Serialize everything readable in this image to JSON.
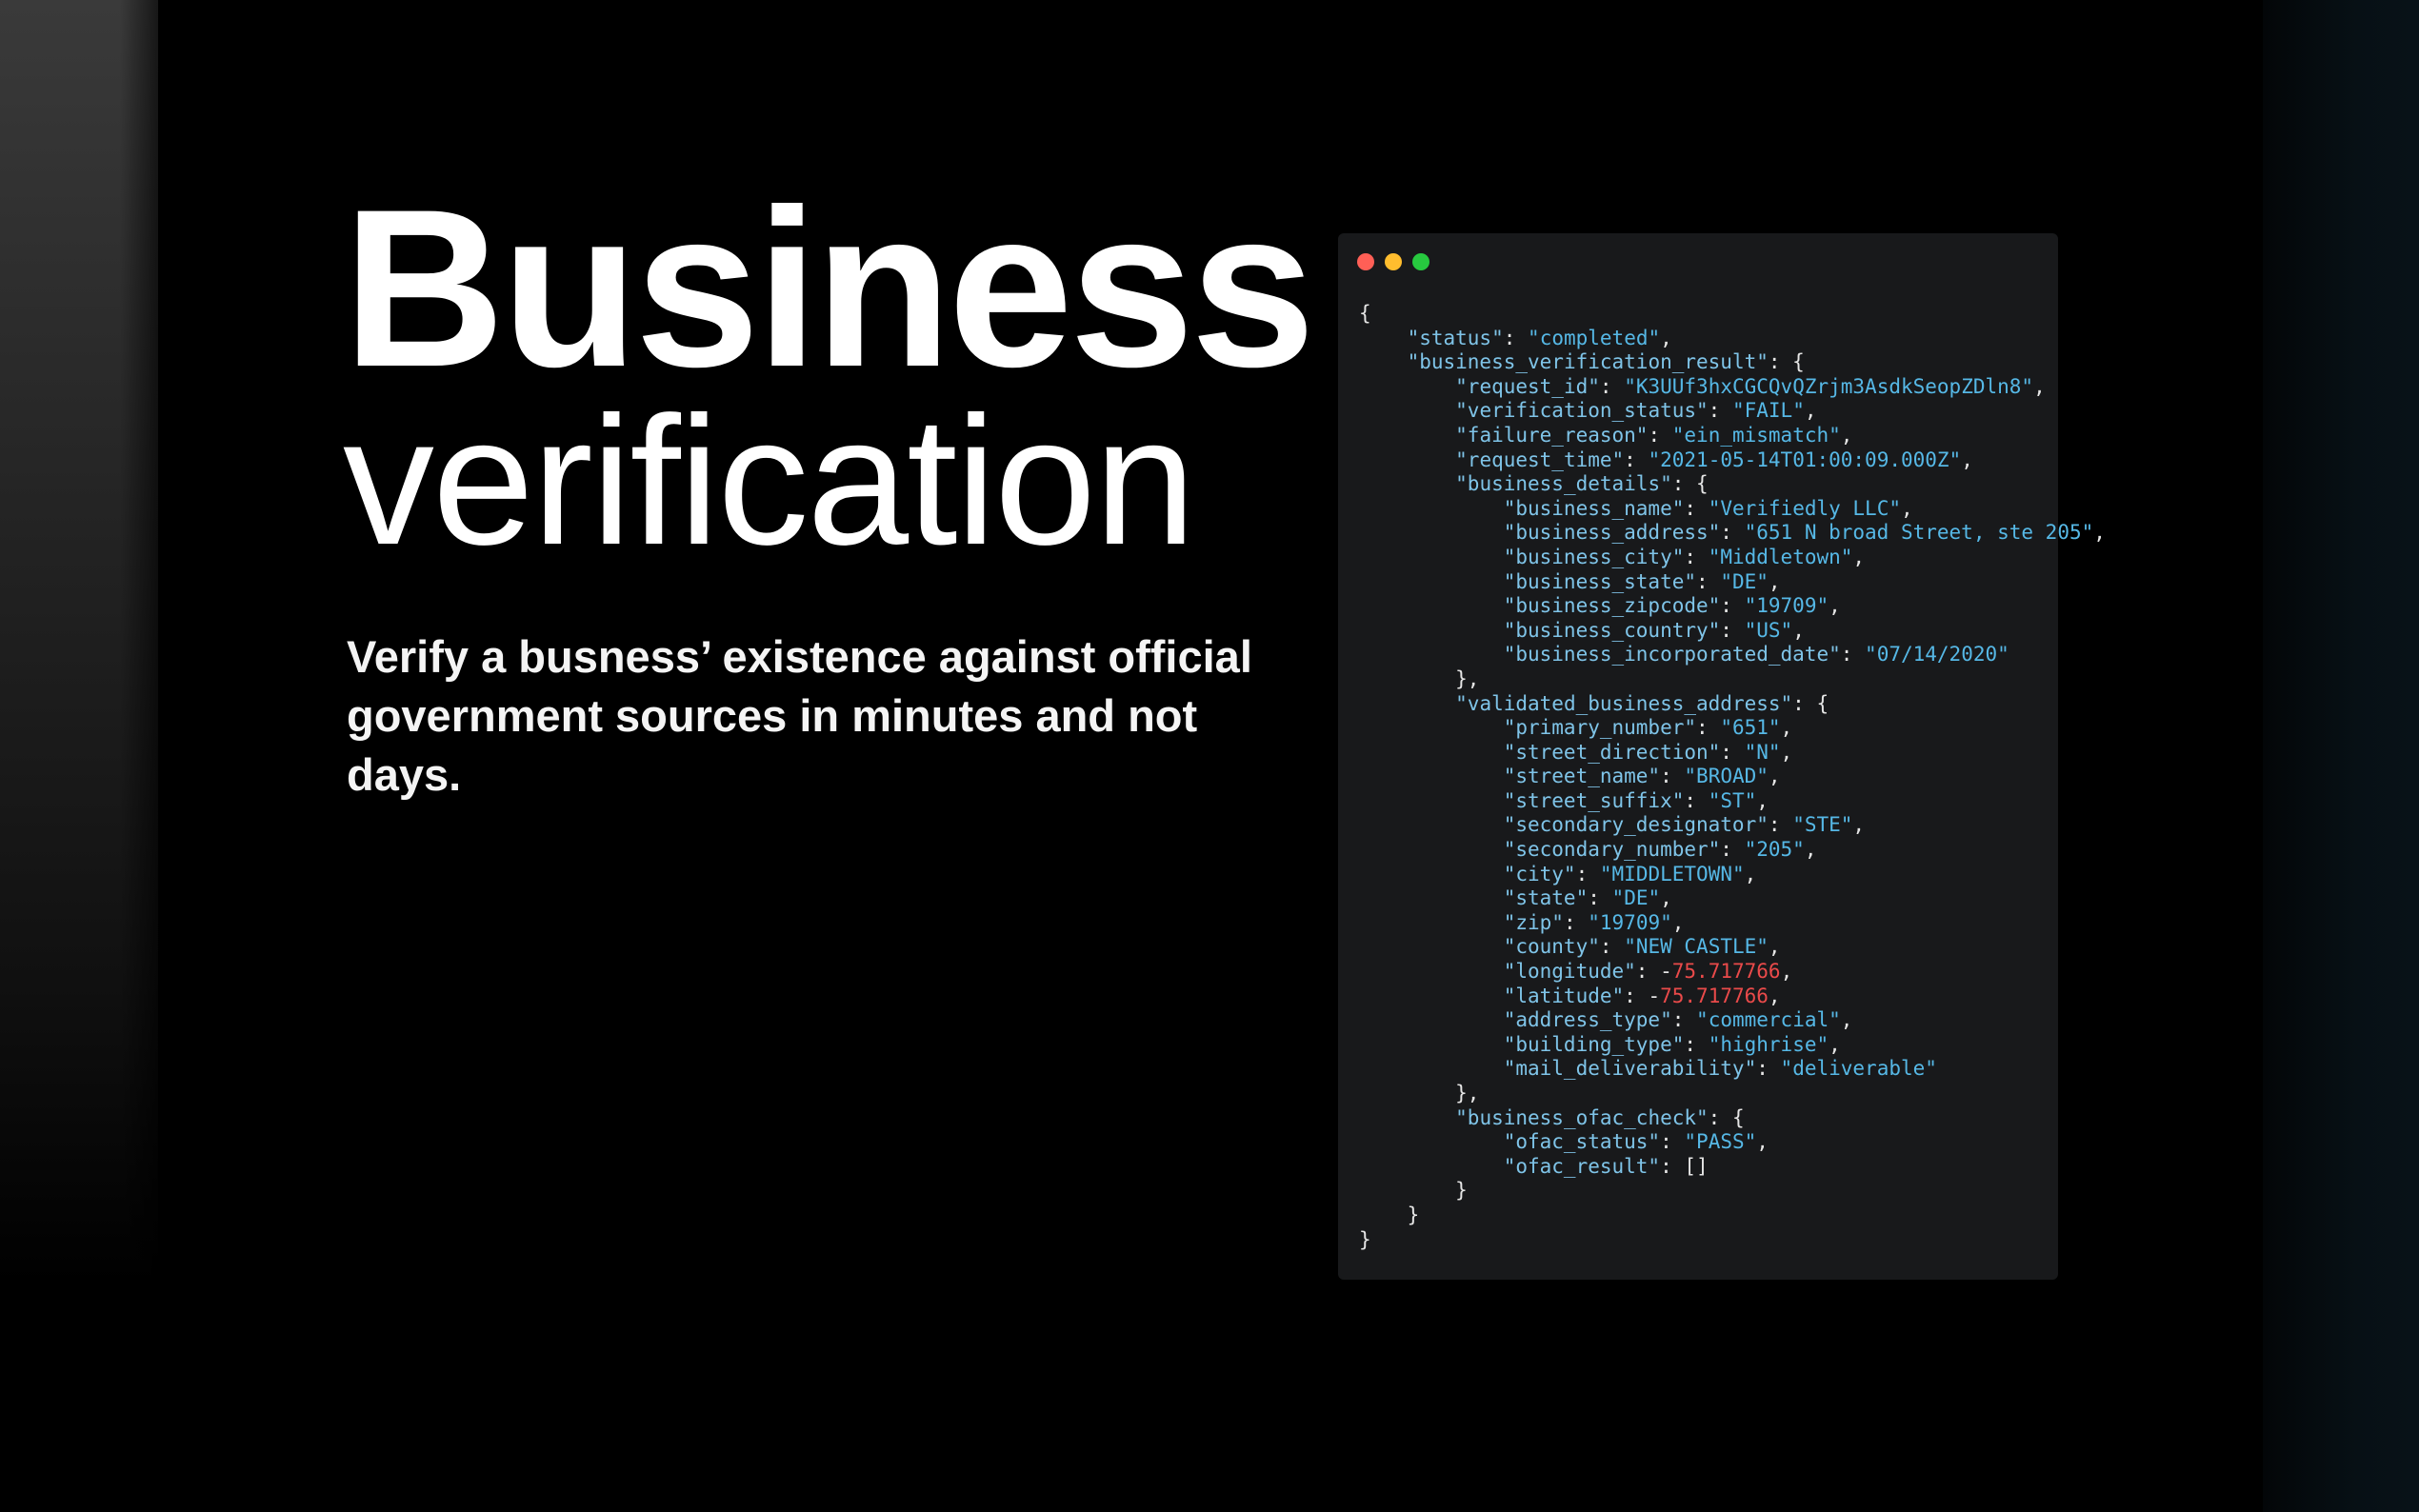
{
  "hero": {
    "title_line1": "Business",
    "title_line2": "verification",
    "description": "Verify a busness’ existence against official government sources in minutes and not days."
  },
  "code_window": {
    "traffic_lights": [
      {
        "name": "close",
        "color": "#ff5f56"
      },
      {
        "name": "minimize",
        "color": "#ffbd2e"
      },
      {
        "name": "maximize",
        "color": "#27c93f"
      }
    ],
    "lines": [
      {
        "indent": 0,
        "text": "{"
      },
      {
        "indent": 1,
        "key": "status",
        "value": "completed",
        "type": "string",
        "suffix": ","
      },
      {
        "indent": 1,
        "key": "business_verification_result",
        "suffix": " {"
      },
      {
        "indent": 2,
        "key": "request_id",
        "value": "K3UUf3hxCGCQvQZrjm3AsdkSeopZDln8",
        "type": "string",
        "suffix": ","
      },
      {
        "indent": 2,
        "key": "verification_status",
        "value": "FAIL",
        "type": "string",
        "suffix": ","
      },
      {
        "indent": 2,
        "key": "failure_reason",
        "value": "ein_mismatch",
        "type": "string",
        "suffix": ","
      },
      {
        "indent": 2,
        "key": "request_time",
        "value": "2021-05-14T01:00:09.000Z",
        "type": "string",
        "suffix": ","
      },
      {
        "indent": 2,
        "key": "business_details",
        "suffix": " {"
      },
      {
        "indent": 3,
        "key": "business_name",
        "value": "Verifiedly LLC",
        "type": "string",
        "suffix": ","
      },
      {
        "indent": 3,
        "key": "business_address",
        "value": "651 N broad Street, ste 205",
        "type": "string",
        "suffix": ","
      },
      {
        "indent": 3,
        "key": "business_city",
        "value": "Middletown",
        "type": "string",
        "suffix": ","
      },
      {
        "indent": 3,
        "key": "business_state",
        "value": "DE",
        "type": "string",
        "suffix": ","
      },
      {
        "indent": 3,
        "key": "business_zipcode",
        "value": "19709",
        "type": "string",
        "suffix": ","
      },
      {
        "indent": 3,
        "key": "business_country",
        "value": "US",
        "type": "string",
        "suffix": ","
      },
      {
        "indent": 3,
        "key": "business_incorporated_date",
        "value": "07/14/2020",
        "type": "string",
        "suffix": ""
      },
      {
        "indent": 2,
        "text": "},"
      },
      {
        "indent": 2,
        "key": "validated_business_address",
        "suffix": " {"
      },
      {
        "indent": 3,
        "key": "primary_number",
        "value": "651",
        "type": "string",
        "suffix": ","
      },
      {
        "indent": 3,
        "key": "street_direction",
        "value": "N",
        "type": "string",
        "suffix": ","
      },
      {
        "indent": 3,
        "key": "street_name",
        "value": "BROAD",
        "type": "string",
        "suffix": ","
      },
      {
        "indent": 3,
        "key": "street_suffix",
        "value": "ST",
        "type": "string",
        "suffix": ","
      },
      {
        "indent": 3,
        "key": "secondary_designator",
        "value": "STE",
        "type": "string",
        "suffix": ","
      },
      {
        "indent": 3,
        "key": "secondary_number",
        "value": "205",
        "type": "string",
        "suffix": ","
      },
      {
        "indent": 3,
        "key": "city",
        "value": "MIDDLETOWN",
        "type": "string",
        "suffix": ","
      },
      {
        "indent": 3,
        "key": "state",
        "value": "DE",
        "type": "string",
        "suffix": ","
      },
      {
        "indent": 3,
        "key": "zip",
        "value": "19709",
        "type": "string",
        "suffix": ","
      },
      {
        "indent": 3,
        "key": "county",
        "value": "NEW CASTLE",
        "type": "string",
        "suffix": ","
      },
      {
        "indent": 3,
        "key": "longitude",
        "value": "75.717766",
        "type": "number",
        "sign": "-",
        "suffix": ","
      },
      {
        "indent": 3,
        "key": "latitude",
        "value": "75.717766",
        "type": "number",
        "sign": "-",
        "suffix": ","
      },
      {
        "indent": 3,
        "key": "address_type",
        "value": "commercial",
        "type": "string",
        "suffix": ","
      },
      {
        "indent": 3,
        "key": "building_type",
        "value": "highrise",
        "type": "string",
        "suffix": ","
      },
      {
        "indent": 3,
        "key": "mail_deliverability",
        "value": "deliverable",
        "type": "string",
        "suffix": ""
      },
      {
        "indent": 2,
        "text": "},"
      },
      {
        "indent": 2,
        "key": "business_ofac_check",
        "suffix": " {"
      },
      {
        "indent": 3,
        "key": "ofac_status",
        "value": "PASS",
        "type": "string",
        "suffix": ","
      },
      {
        "indent": 3,
        "key": "ofac_result",
        "value": "[]",
        "type": "raw",
        "suffix": ""
      },
      {
        "indent": 2,
        "text": "}"
      },
      {
        "indent": 1,
        "text": "}"
      },
      {
        "indent": 0,
        "text": "}"
      }
    ]
  }
}
